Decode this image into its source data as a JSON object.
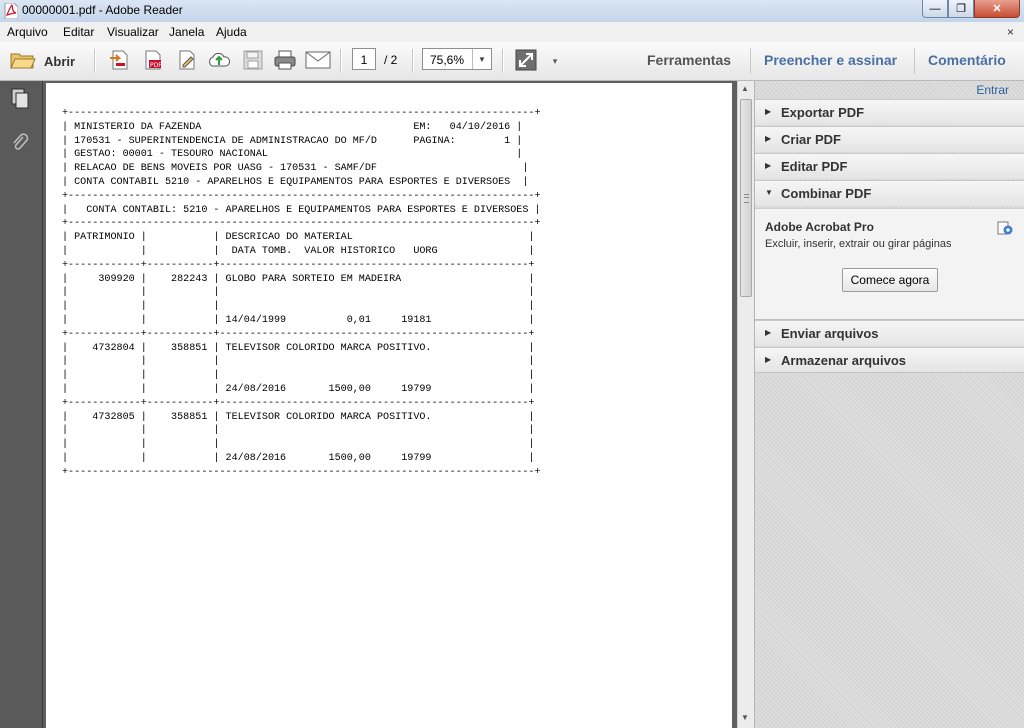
{
  "window": {
    "title": "00000001.pdf - Adobe Reader",
    "minimize": "—",
    "maximize": "❐",
    "close": "✕"
  },
  "menu": {
    "items": [
      "Arquivo",
      "Editar",
      "Visualizar",
      "Janela",
      "Ajuda"
    ],
    "close": "×"
  },
  "toolbar": {
    "open_label": "Abrir",
    "page_current": "1",
    "page_total": "/ 2",
    "zoom": "75,6%",
    "tabs": [
      "Ferramentas",
      "Preencher e assinar",
      "Comentário"
    ]
  },
  "document": {
    "lines": [
      "+-----------------------------------------------------------------------------+",
      "| MINISTERIO DA FAZENDA                                   EM:   04/10/2016 |",
      "| 170531 - SUPERINTENDENCIA DE ADMINISTRACAO DO MF/D      PAGINA:        1 |",
      "| GESTAO: 00001 - TESOURO NACIONAL                                         |",
      "| RELACAO DE BENS MOVEIS POR UASG - 170531 - SAMF/DF                        |",
      "| CONTA CONTABIL 5210 - APARELHOS E EQUIPAMENTOS PARA ESPORTES E DIVERSOES  |",
      "+-----------------------------------------------------------------------------+",
      "|   CONTA CONTABIL: 5210 - APARELHOS E EQUIPAMENTOS PARA ESPORTES E DIVERSOES |",
      "+-----------------------------------------------------------------------------+",
      "| PATRIMONIO |           | DESCRICAO DO MATERIAL                             |",
      "|            |           |  DATA TOMB.  VALOR HISTORICO   UORG               |",
      "+------------+-----------+---------------------------------------------------+",
      "|     309920 |    282243 | GLOBO PARA SORTEIO EM MADEIRA                     |",
      "|            |           |                                                   |",
      "|            |           |                                                   |",
      "|            |           | 14/04/1999          0,01     19181                |",
      "+------------+-----------+---------------------------------------------------+",
      "|    4732804 |    358851 | TELEVISOR COLORIDO MARCA POSITIVO.                |",
      "|            |           |                                                   |",
      "|            |           |                                                   |",
      "|            |           | 24/08/2016       1500,00     19799                |",
      "+------------+-----------+---------------------------------------------------+",
      "|    4732805 |    358851 | TELEVISOR COLORIDO MARCA POSITIVO.                |",
      "|            |           |                                                   |",
      "|            |           |                                                   |",
      "|            |           | 24/08/2016       1500,00     19799                |",
      "+-----------------------------------------------------------------------------+"
    ]
  },
  "right_pane": {
    "entrar": "Entrar",
    "panels": [
      {
        "label": "Exportar PDF",
        "expanded": false
      },
      {
        "label": "Criar PDF",
        "expanded": false
      },
      {
        "label": "Editar PDF",
        "expanded": false
      },
      {
        "label": "Combinar PDF",
        "expanded": true
      },
      {
        "label": "Enviar arquivos",
        "expanded": false
      },
      {
        "label": "Armazenar arquivos",
        "expanded": false
      }
    ],
    "combinar": {
      "title": "Adobe Acrobat Pro",
      "description": "Excluir, inserir, extrair ou girar páginas",
      "button": "Comece agora"
    }
  },
  "colors": {
    "tab_text": "#4a6fa5",
    "tab_text_dark": "#555555",
    "pdf_red": "#c8102e",
    "doc_background": "#5f5f5f"
  }
}
